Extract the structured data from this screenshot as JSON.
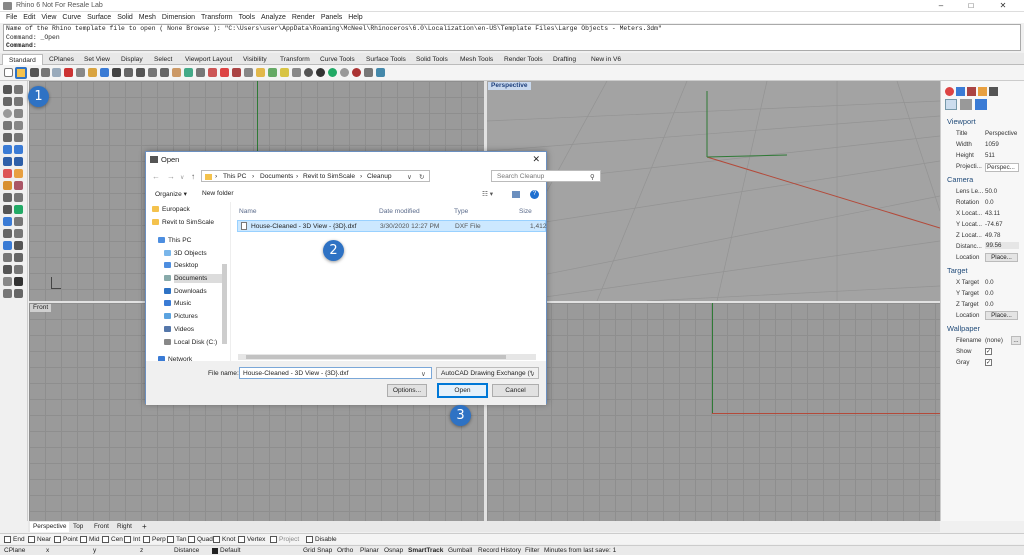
{
  "app": {
    "title": "Rhino 6 Not For Resale Lab"
  },
  "menu": [
    "File",
    "Edit",
    "View",
    "Curve",
    "Surface",
    "Solid",
    "Mesh",
    "Dimension",
    "Transform",
    "Tools",
    "Analyze",
    "Render",
    "Panels",
    "Help"
  ],
  "command": {
    "line1": "Name of the Rhino template file to open ( None  Browse ): \"C:\\Users\\user\\AppData\\Roaming\\McNeel\\Rhinoceros\\6.0\\Localization\\en-US\\Template Files\\Large Objects - Meters.3dm\"",
    "line2": "Command: _Open",
    "line3": "Command:"
  },
  "tabs": [
    "Standard",
    "CPlanes",
    "Set View",
    "Display",
    "Select",
    "Viewport Layout",
    "Visibility",
    "Transform",
    "Curve Tools",
    "Surface Tools",
    "Solid Tools",
    "Mesh Tools",
    "Render Tools",
    "Drafting",
    "New in V6"
  ],
  "viewports": {
    "perspective": "Perspective",
    "front": "Front"
  },
  "panel": {
    "viewport_title": "Viewport",
    "title_label": "Title",
    "title_value": "Perspective",
    "width_label": "Width",
    "width_value": "1059",
    "height_label": "Height",
    "height_value": "511",
    "proj_label": "Projecti...",
    "proj_value": "Perspec...",
    "camera_title": "Camera",
    "lens_label": "Lens Le...",
    "lens_value": "50.0",
    "rot_label": "Rotation",
    "rot_value": "0.0",
    "xloc_label": "X Locat...",
    "xloc_value": "43.11",
    "yloc_label": "Y Locat...",
    "yloc_value": "-74.67",
    "zloc_label": "Z Locat...",
    "zloc_value": "49.78",
    "dist_label": "Distanc...",
    "dist_value": "99.56",
    "loc_label": "Location",
    "loc_btn": "Place...",
    "target_title": "Target",
    "xt_label": "X Target",
    "xt_value": "0.0",
    "yt_label": "Y Target",
    "yt_value": "0.0",
    "zt_label": "Z Target",
    "zt_value": "0.0",
    "tloc_label": "Location",
    "tloc_btn": "Place...",
    "wall_title": "Wallpaper",
    "fname_label": "Filename",
    "fname_value": "(none)",
    "fname_btn": "...",
    "show_label": "Show",
    "gray_label": "Gray"
  },
  "view_tabs": [
    "Perspective",
    "Top",
    "Front",
    "Right"
  ],
  "osnaps": [
    "End",
    "Near",
    "Point",
    "Mid",
    "Cen",
    "Int",
    "Perp",
    "Tan",
    "Quad",
    "Knot",
    "Vertex",
    "Project",
    "Disable"
  ],
  "status": {
    "cplane": "CPlane",
    "x": "x",
    "y": "y",
    "z": "z",
    "distance": "Distance",
    "layer": "Default",
    "items": [
      "Grid Snap",
      "Ortho",
      "Planar",
      "Osnap",
      "SmartTrack",
      "Gumball",
      "Record History",
      "Filter",
      "Minutes from last save: 1"
    ]
  },
  "dialog": {
    "title": "Open",
    "path": [
      "This PC",
      "Documents",
      "Revit to SimScale",
      "Cleanup"
    ],
    "search_placeholder": "Search Cleanup",
    "organize": "Organize ▾",
    "new_folder": "New folder",
    "nav": [
      "Europack",
      "Revit to SimScale",
      "This PC",
      "3D Objects",
      "Desktop",
      "Documents",
      "Downloads",
      "Music",
      "Pictures",
      "Videos",
      "Local Disk (C:)",
      "Network"
    ],
    "columns": [
      "Name",
      "Date modified",
      "Type",
      "Size"
    ],
    "file": {
      "name": "House-Cleaned - 3D View - {3D}.dxf",
      "date": "3/30/2020 12:27 PM",
      "type": "DXF File",
      "size": "1,412"
    },
    "filename_label": "File name:",
    "filename_value": "House-Cleaned - 3D View - {3D}.dxf",
    "filetype": "AutoCAD Drawing Exchange (*.",
    "options_btn": "Options...",
    "open_btn": "Open",
    "cancel_btn": "Cancel"
  },
  "badges": [
    "1",
    "2",
    "3"
  ]
}
